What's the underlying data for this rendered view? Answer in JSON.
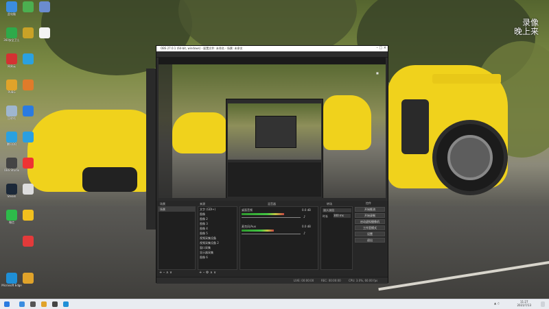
{
  "overlay_text": [
    "录像",
    "晚上来"
  ],
  "desktop_icons": [
    {
      "label": "此电脑",
      "color": "#3b8de0",
      "icon": "computer-icon"
    },
    {
      "label": "360安全卫士",
      "color": "#2eaa4a",
      "icon": "shield-app-icon"
    },
    {
      "label": "网易云",
      "color": "#d33232",
      "icon": "music-icon"
    },
    {
      "label": "PUBG",
      "color": "#e0a32a",
      "icon": "game-icon"
    },
    {
      "label": "回收站",
      "color": "#9fb6cf",
      "icon": "recycle-bin-icon"
    },
    {
      "label": "腾讯QQ",
      "color": "#2aa1e0",
      "icon": "qq-icon"
    },
    {
      "label": "OBS Studio",
      "color": "#444444",
      "icon": "obs-icon"
    },
    {
      "label": "Steam",
      "color": "#1b2838",
      "icon": "steam-icon"
    },
    {
      "label": "微信",
      "color": "#2dbb4a",
      "icon": "wechat-icon"
    },
    {
      "label": "Microsoft Edge",
      "color": "#1f8fd6",
      "icon": "edge-icon"
    }
  ],
  "obs": {
    "title": "OBS 27.0.1 (64-bit, windows) - 配置文件: 未命名 - 场景: 未命名",
    "menu": [
      "文件(F)",
      "编辑(E)",
      "视图(V)",
      "停靠部件(D)",
      "配置文件(P)",
      "场景集合(S)",
      "工具(T)",
      "帮助(H)"
    ],
    "scenes_header": "场景",
    "sources_header": "来源",
    "mixer_header": "混音器",
    "transitions_header": "转场",
    "controls_header": "控件",
    "scene_items": [
      "场景"
    ],
    "source_items": [
      "文字 (GDI+)",
      "图像",
      "图像 2",
      "图像 3",
      "图像 4",
      "图像 5",
      "视频采集设备",
      "视频采集设备 2",
      "窗口采集",
      "显示器采集",
      "图像 6"
    ],
    "mixer_tracks": [
      {
        "name": "桌面音频",
        "db": "0.0 dB",
        "level": 0.72
      },
      {
        "name": "麦克风/Aux",
        "db": "0.0 dB",
        "level": 0.55
      }
    ],
    "transition": "淡入淡出",
    "duration_label": "时长",
    "duration_value": "300 ms",
    "controls": [
      "开始推流",
      "开始录制",
      "启动虚拟摄像机",
      "工作室模式",
      "设置",
      "退出"
    ],
    "status": {
      "live": "LIVE: 00:00:00",
      "rec": "REC: 00:00:00",
      "cpu": "CPU: 3.0%, 60.00 fps"
    }
  },
  "tray": {
    "time": "11:27",
    "date": "2021/7/13"
  },
  "colors": {
    "accent": "#f0d21c",
    "obs_bg": "#2b2b2b",
    "taskbar": "#e9ecf1"
  }
}
